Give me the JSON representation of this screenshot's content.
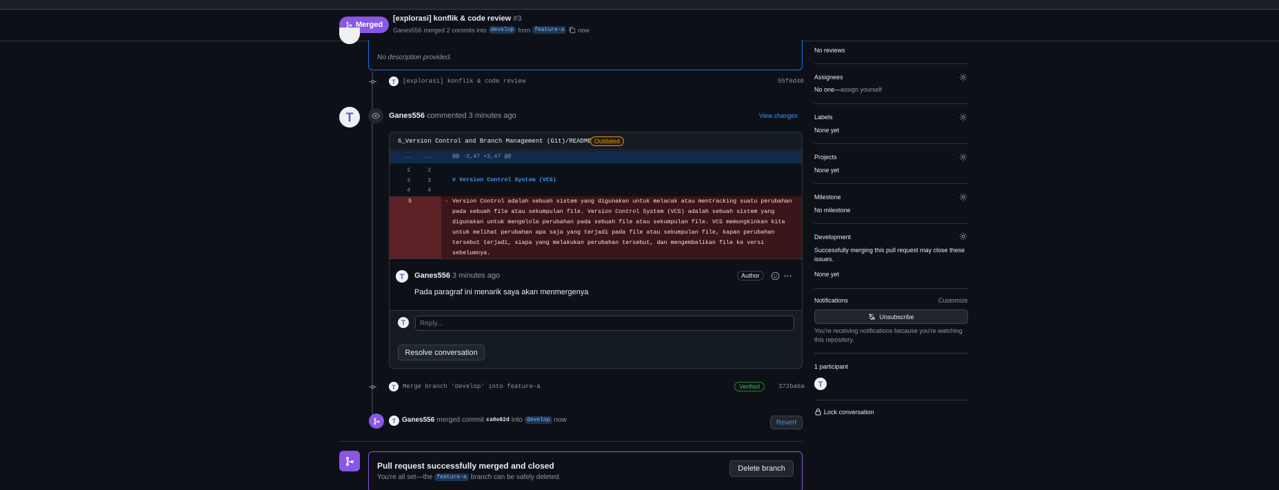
{
  "header": {
    "status_badge": "Merged",
    "title": "[explorasi] konflik & code review",
    "number": "#3",
    "author": "Ganes556",
    "merged_text": "merged 2 commits into",
    "base_branch": "develop",
    "from_text": "from",
    "head_branch": "feature-a",
    "time": "now"
  },
  "description": {
    "text": "No description provided."
  },
  "commit1": {
    "message": "[explorasi] konflik & code review",
    "sha": "55f6d40"
  },
  "review": {
    "author": "Ganes556",
    "action": "commented 3 minutes ago",
    "view_changes": "View changes",
    "file_path": "6_Version Control and Branch Management (Git)/README.md",
    "outdated_label": "Outdated",
    "hunk_dots_left": "...",
    "hunk_dots_right": "...",
    "hunk_header": "@@ -2,47 +2,47 @@",
    "lines": [
      {
        "old": "2",
        "new": "2",
        "text": ""
      },
      {
        "old": "3",
        "new": "3",
        "text": "# Version Control System (VCS)"
      },
      {
        "old": "4",
        "new": "4",
        "text": ""
      }
    ],
    "deleted_line_num": "5",
    "deleted_marker": "-",
    "deleted_lines": [
      "Version Control adalah sebuah sistem yang digunakan untuk melacak atau mentracking suatu perubahan",
      "pada sebuah file atau sekumpulan file. Version Control System (VCS) adalah sebuah sistem yang",
      "digunakan untuk mengelola perubahan pada sebuah file atau sekumpulan file. VCS memungkinkan kita",
      "untuk melihat perubahan apa saja yang terjadi pada file atau sekumpulan file, kapan perubahan",
      "tersebut terjadi, siapa yang melakukan perubahan tersebut, dan mengembalikan file ke versi",
      "sebelumnya."
    ],
    "comment": {
      "author": "Ganes556",
      "time": "3 minutes ago",
      "role_badge": "Author",
      "body": "Pada paragraf ini menarik saya akan menmergenya"
    },
    "reply_placeholder": "Reply...",
    "resolve_button": "Resolve conversation"
  },
  "commit2": {
    "message": "Merge branch 'develop' into feature-a",
    "verified": "Verified",
    "sha": "372ba6a"
  },
  "merge_event": {
    "author": "Ganes556",
    "text": "merged commit",
    "sha": "ca0e82d",
    "into": "into",
    "branch": "develop",
    "time": "now",
    "revert": "Revert"
  },
  "merged_box": {
    "title": "Pull request successfully merged and closed",
    "prefix": "You're all set—the",
    "branch": "feature-a",
    "suffix": "branch can be safely deleted.",
    "delete_button": "Delete branch"
  },
  "sidebar": {
    "reviews_value": "No reviews",
    "assignees_label": "Assignees",
    "assignees_value": "No one—",
    "assign_yourself": "assign yourself",
    "labels_label": "Labels",
    "labels_value": "None yet",
    "projects_label": "Projects",
    "projects_value": "None yet",
    "milestone_label": "Milestone",
    "milestone_value": "No milestone",
    "development_label": "Development",
    "development_text": "Successfully merging this pull request may close these issues.",
    "development_value": "None yet",
    "notifications_label": "Notifications",
    "customize": "Customize",
    "unsubscribe": "Unsubscribe",
    "notifications_text": "You're receiving notifications because you're watching this repository.",
    "participants_label": "1 participant",
    "lock": "Lock conversation"
  },
  "colors": {
    "merged_purple": "#8957e5",
    "deleted_bg": "#3b1519",
    "hunk_bg": "#0f2a4c",
    "link_blue": "#4493f8"
  }
}
